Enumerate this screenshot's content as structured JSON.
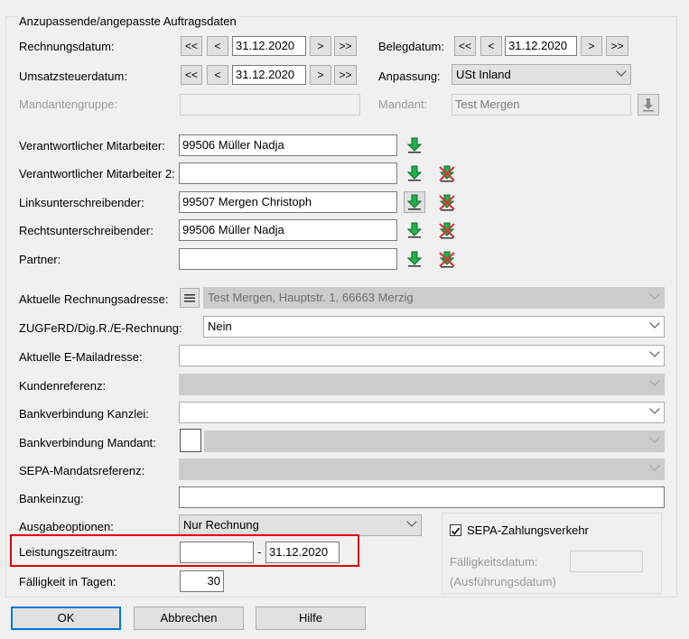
{
  "group_title": "Anzupassende/angepasste Auftragsdaten",
  "rechnungsdatum": {
    "label": "Rechnungsdatum:",
    "value": "31.12.2020"
  },
  "belegdatum": {
    "label": "Belegdatum:",
    "value": "31.12.2020"
  },
  "umsatzsteuerdatum": {
    "label": "Umsatzsteuerdatum:",
    "value": "31.12.2020"
  },
  "anpassung": {
    "label": "Anpassung:",
    "value": "USt Inland"
  },
  "nav": {
    "first": "<<",
    "prev": "<",
    "next": ">",
    "last": ">>"
  },
  "mandantengruppe": {
    "label": "Mandantengruppe:",
    "value": ""
  },
  "mandant": {
    "label": "Mandant:",
    "value": "Test Mergen"
  },
  "personen": [
    {
      "label": "Verantwortlicher Mitarbeiter:",
      "value": "99506 Müller Nadja"
    },
    {
      "label": "Verantwortlicher Mitarbeiter 2:",
      "value": ""
    },
    {
      "label": "Linksunterschreibender:",
      "value": "99507 Mergen Christoph"
    },
    {
      "label": "Rechtsunterschreibender:",
      "value": "99506 Müller Nadja"
    },
    {
      "label": "Partner:",
      "value": ""
    }
  ],
  "rechnungsadresse": {
    "label": "Aktuelle Rechnungsadresse:",
    "value": "Test Mergen, Hauptstr. 1, 66663 Merzig"
  },
  "zugferd": {
    "label": "ZUGFeRD/Dig.R./E-Rechnung:",
    "value": "Nein"
  },
  "emailadresse": {
    "label": "Aktuelle E-Mailadresse:",
    "value": ""
  },
  "kundenreferenz": {
    "label": "Kundenreferenz:",
    "value": ""
  },
  "bank_kanzlei": {
    "label": "Bankverbindung Kanzlei:",
    "value": ""
  },
  "bank_mandant": {
    "label": "Bankverbindung Mandant:",
    "value": ""
  },
  "sepa_ref": {
    "label": "SEPA-Mandatsreferenz:",
    "value": ""
  },
  "bankeinzug": {
    "label": "Bankeinzug:",
    "value": ""
  },
  "ausgabeoptionen": {
    "label": "Ausgabeoptionen:",
    "value": "Nur Rechnung"
  },
  "leistungszeitraum": {
    "label": "Leistungszeitraum:",
    "from": "",
    "sep": "-",
    "to": "31.12.2020"
  },
  "faelligkeit": {
    "label": "Fälligkeit in Tagen:",
    "value": "30"
  },
  "sepa": {
    "checkbox_label": "SEPA-Zahlungsverkehr",
    "checked": true,
    "faellig_label_1": "Fälligkeitsdatum:",
    "faellig_label_2": "(Ausführungsdatum)",
    "faellig_value": ""
  },
  "buttons": {
    "ok": "OK",
    "abbrechen": "Abbrechen",
    "hilfe": "Hilfe"
  },
  "colors": {
    "accent": "#0078d7",
    "highlight": "#e00000",
    "arrow_green": "#22b14c",
    "remove_red": "#e0303a"
  }
}
